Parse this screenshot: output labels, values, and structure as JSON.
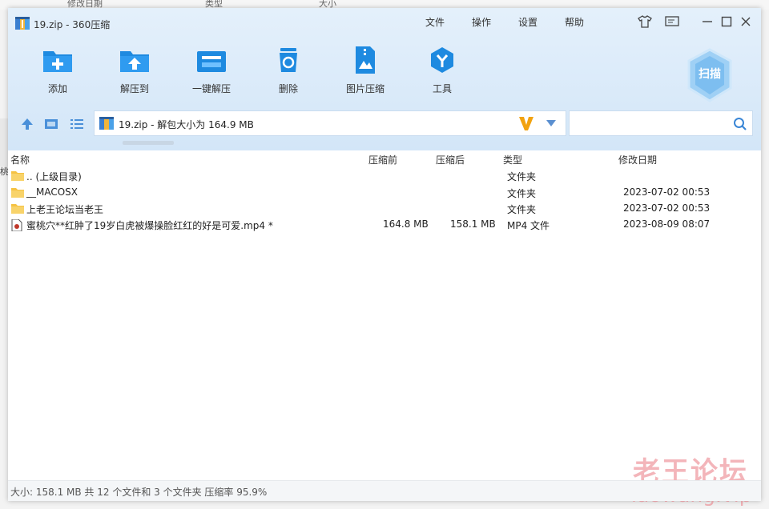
{
  "window": {
    "title": "19.zip - 360压缩"
  },
  "menu": [
    "文件",
    "操作",
    "设置",
    "帮助"
  ],
  "toolbar": [
    {
      "label": "添加",
      "icon": "add-icon"
    },
    {
      "label": "解压到",
      "icon": "extract-to-icon"
    },
    {
      "label": "一键解压",
      "icon": "one-click-extract-icon"
    },
    {
      "label": "删除",
      "icon": "delete-icon"
    },
    {
      "label": "图片压缩",
      "icon": "image-compress-icon"
    },
    {
      "label": "工具",
      "icon": "tools-icon"
    }
  ],
  "scan": {
    "label": "扫描"
  },
  "address": {
    "path": "19.zip - 解包大小为 164.9 MB"
  },
  "search": {
    "placeholder": ""
  },
  "columns": {
    "name": "名称",
    "before": "压缩前",
    "after": "压缩后",
    "type": "类型",
    "modified": "修改日期"
  },
  "files": [
    {
      "name": ".. (上级目录)",
      "before": "",
      "after": "",
      "type": "文件夹",
      "modified": "",
      "icon": "folder-icon"
    },
    {
      "name": "__MACOSX",
      "before": "",
      "after": "",
      "type": "文件夹",
      "modified": "2023-07-02 00:53",
      "icon": "folder-icon"
    },
    {
      "name": "上老王论坛当老王",
      "before": "",
      "after": "",
      "type": "文件夹",
      "modified": "2023-07-02 00:53",
      "icon": "folder-icon"
    },
    {
      "name": "蜜桃穴**红肿了19岁白虎被爆操脸红红的好是可爱.mp4 *",
      "before": "164.8 MB",
      "after": "158.1 MB",
      "type": "MP4 文件",
      "modified": "2023-08-09 08:07",
      "icon": "video-file-icon"
    }
  ],
  "status": {
    "text": "大小: 158.1 MB 共 12 个文件和 3 个文件夹 压缩率 95.9%"
  },
  "watermark": {
    "line1": "老王论坛",
    "line2": "laowang.vip"
  },
  "background": {
    "col1": "修改日期",
    "col2": "类型",
    "col3": "大小",
    "side": "桃"
  },
  "colors": {
    "accent": "#1e8ae0",
    "folder": "#f5c242",
    "toolbar_bg": "#d9eaf9",
    "watermark": "#e97882"
  }
}
